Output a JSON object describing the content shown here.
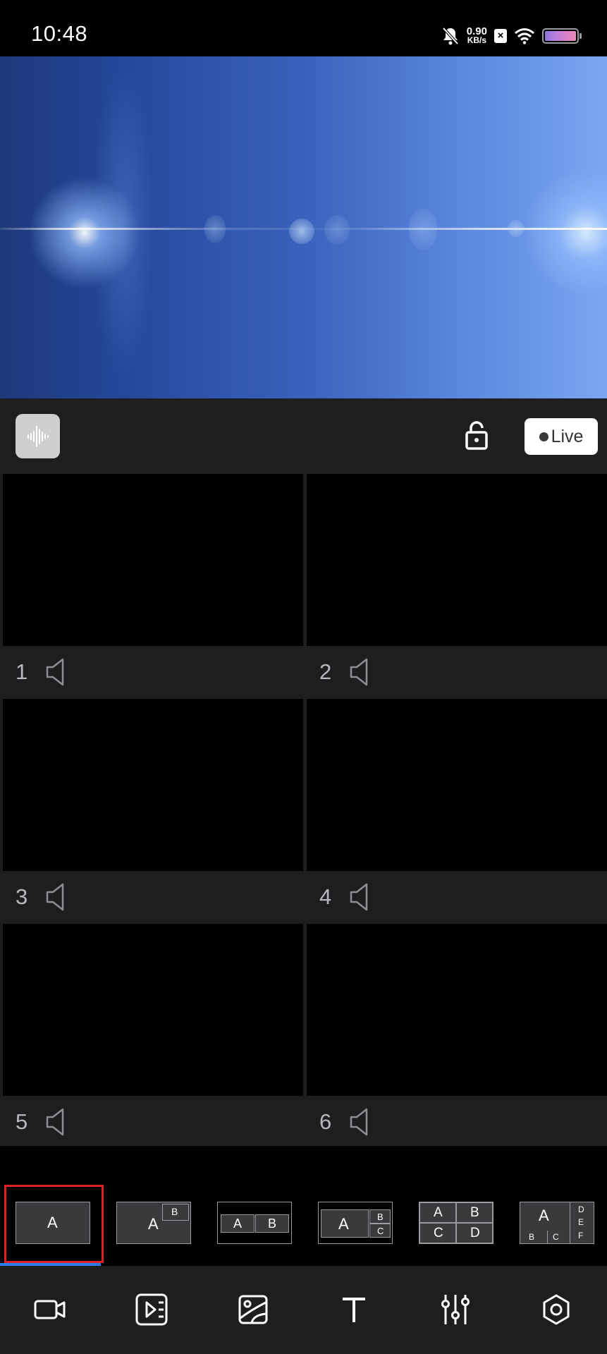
{
  "status_bar": {
    "time": "10:48",
    "net_speed_value": "0.90",
    "net_speed_unit": "KB/s",
    "sim_mark": "×"
  },
  "control_bar": {
    "live_label": "Live"
  },
  "sources": [
    {
      "number": "1"
    },
    {
      "number": "2"
    },
    {
      "number": "3"
    },
    {
      "number": "4"
    },
    {
      "number": "5"
    },
    {
      "number": "6"
    }
  ],
  "layouts": {
    "selected_index": 0,
    "options": [
      {
        "id": "single",
        "labels": [
          "A"
        ]
      },
      {
        "id": "pip",
        "labels": [
          "A",
          "B"
        ]
      },
      {
        "id": "side-by-side",
        "labels": [
          "A",
          "B"
        ]
      },
      {
        "id": "one-plus-two",
        "labels": [
          "A",
          "B",
          "C"
        ]
      },
      {
        "id": "quad",
        "labels": [
          "A",
          "B",
          "C",
          "D"
        ]
      },
      {
        "id": "six",
        "labels": [
          "A",
          "B",
          "C",
          "D",
          "E",
          "F"
        ]
      }
    ]
  },
  "bottom_nav": [
    {
      "icon": "camera-icon"
    },
    {
      "icon": "playlist-icon"
    },
    {
      "icon": "image-icon"
    },
    {
      "icon": "text-icon"
    },
    {
      "icon": "mixer-icon"
    },
    {
      "icon": "settings-icon"
    }
  ]
}
